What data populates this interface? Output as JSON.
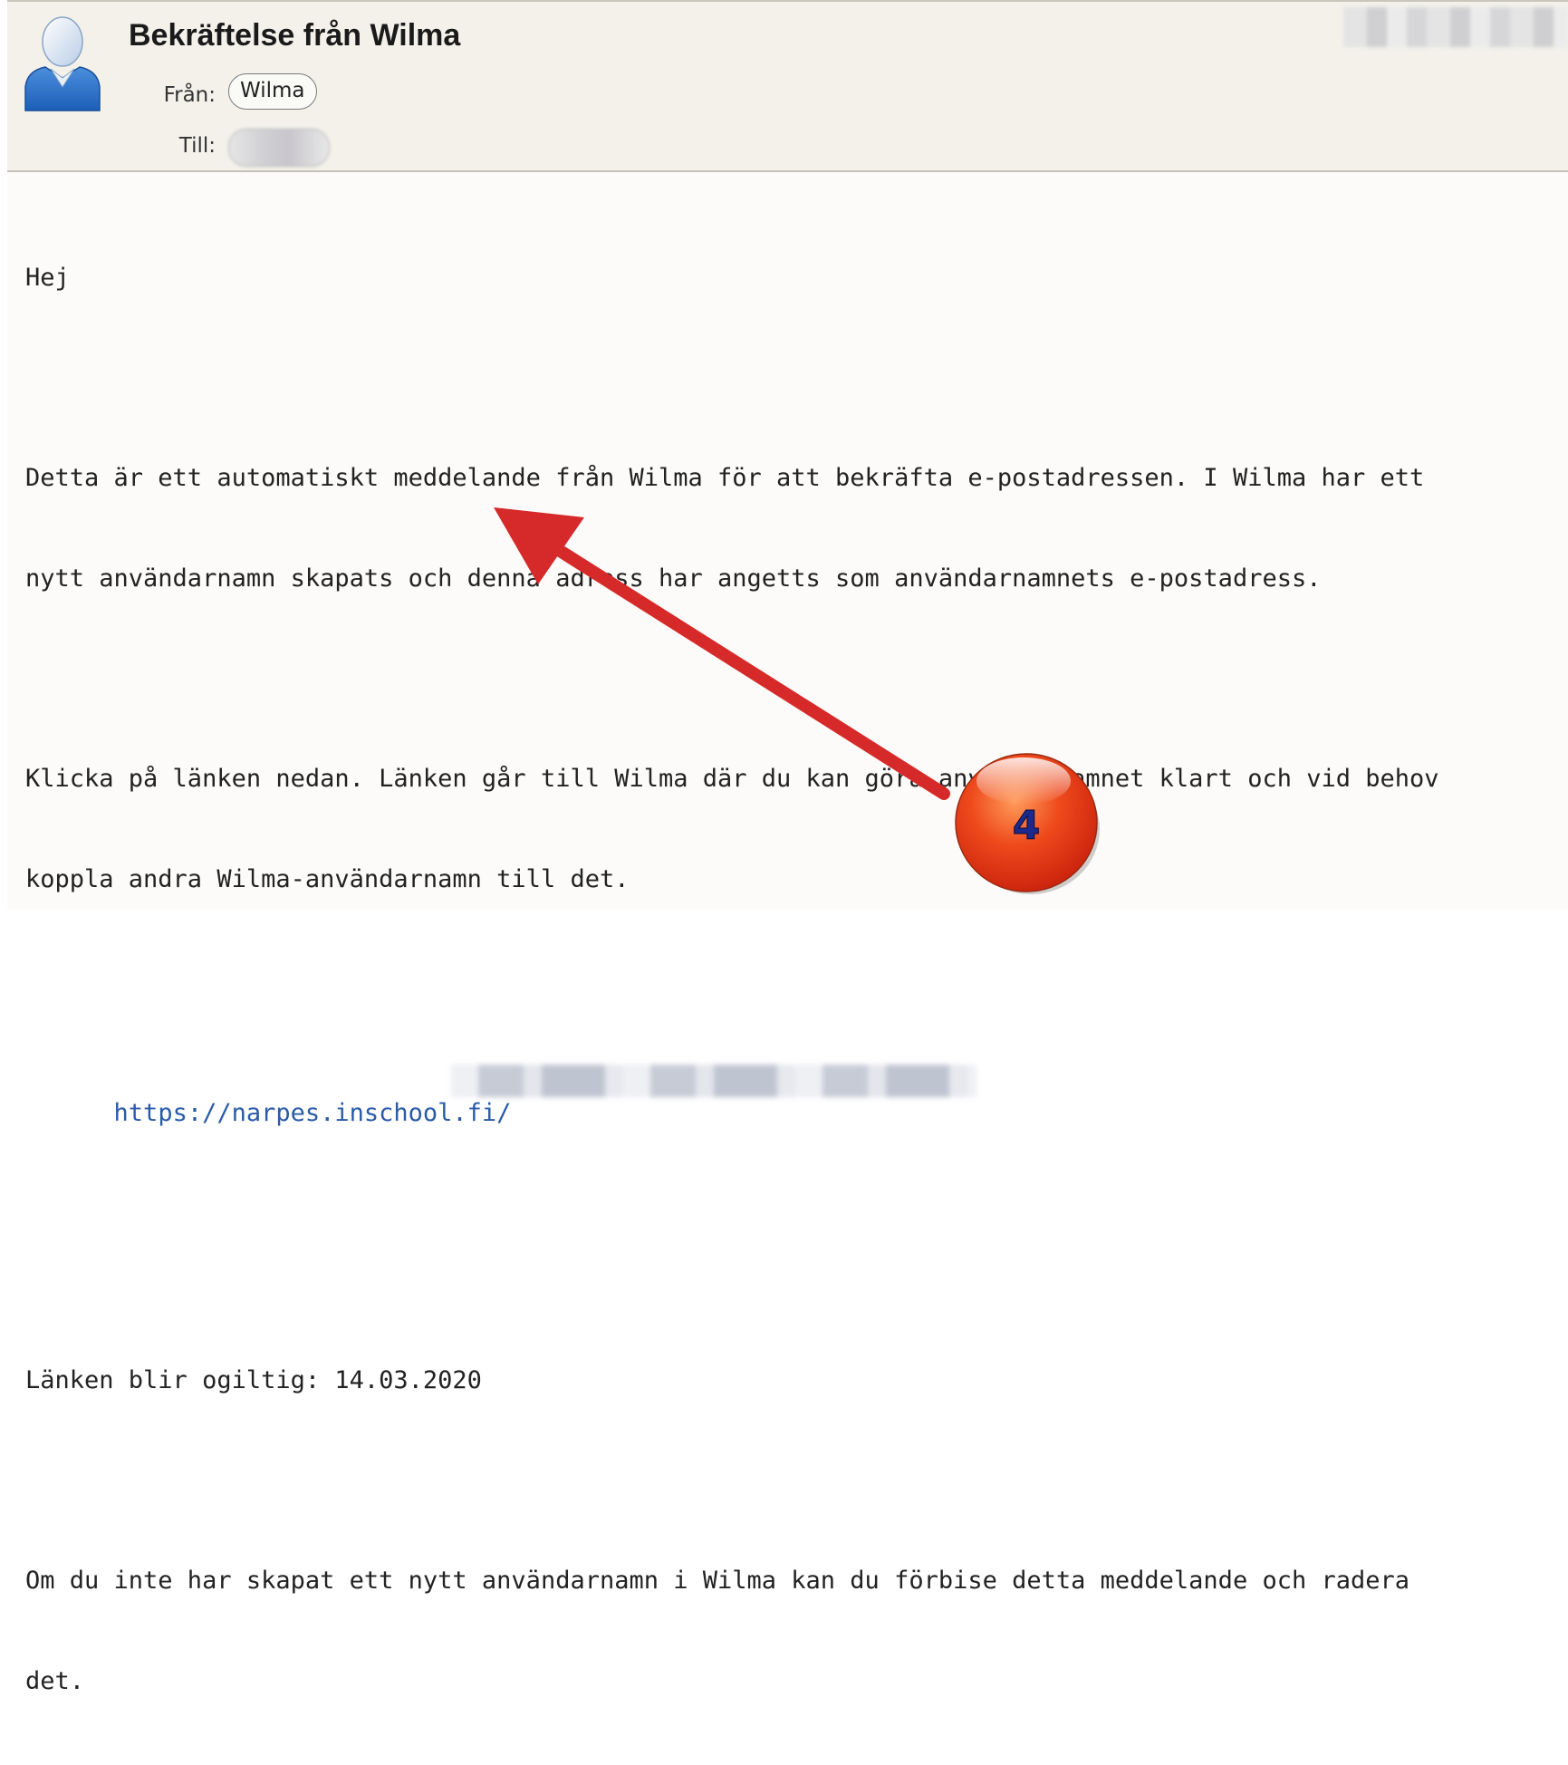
{
  "email": {
    "subject": "Bekräftelse från Wilma",
    "from_label": "Från:",
    "from_value": "Wilma",
    "to_label": "Till:"
  },
  "body": {
    "greeting": "Hej",
    "paragraph1_line1": "Detta är ett automatiskt meddelande från Wilma för att bekräfta e-postadressen. I Wilma har ett",
    "paragraph1_line2": "nytt användarnamn skapats och denna adress har angetts som användarnamnets e-postadress.",
    "paragraph2_line1": "Klicka på länken nedan. Länken går till Wilma där du kan göra användarnamnet klart och vid behov",
    "paragraph2_line2": "koppla andra Wilma-användarnamn till det.",
    "link_text": "https://narpes.inschool.fi/",
    "expiry": "Länken blir ogiltig: 14.03.2020",
    "paragraph3_line1": "Om du inte har skapat ett nytt användarnamn i Wilma kan du förbise detta meddelande och radera",
    "paragraph3_line2": "det."
  },
  "annotation": {
    "step_number": "4",
    "arrow_color": "#d62a2a",
    "badge_color": "#e8421d",
    "number_color": "#1b2a8c"
  },
  "icons": {
    "sender_avatar": "person-avatar-icon"
  }
}
